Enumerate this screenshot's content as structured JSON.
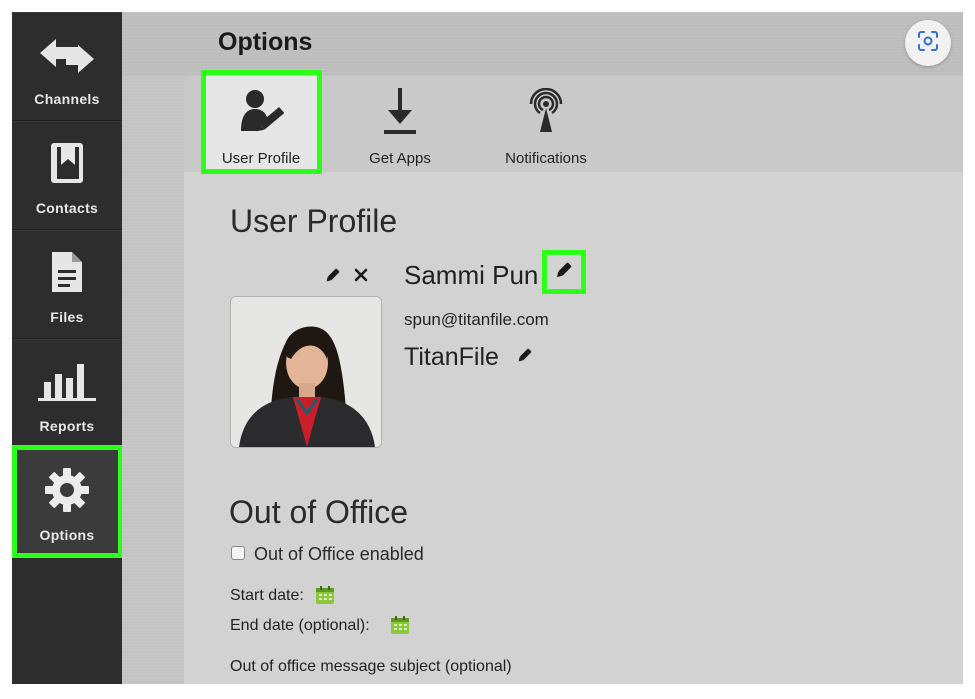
{
  "sidebar": {
    "items": [
      {
        "label": "Channels",
        "icon": "arrows-swap-icon"
      },
      {
        "label": "Contacts",
        "icon": "book-icon"
      },
      {
        "label": "Files",
        "icon": "file-icon"
      },
      {
        "label": "Reports",
        "icon": "bar-chart-icon"
      },
      {
        "label": "Options",
        "icon": "gear-icon",
        "active": true
      }
    ]
  },
  "header": {
    "title": "Options",
    "screenshot_icon": "screenshot-icon"
  },
  "tabs": [
    {
      "label": "User Profile",
      "icon": "user-edit-icon",
      "active": true
    },
    {
      "label": "Get Apps",
      "icon": "download-icon"
    },
    {
      "label": "Notifications",
      "icon": "broadcast-icon"
    }
  ],
  "user_profile": {
    "title": "User Profile",
    "name": "Sammi Pun",
    "email": "spun@titanfile.com",
    "company": "TitanFile"
  },
  "out_of_office": {
    "title": "Out of Office",
    "enabled_label": "Out of Office enabled",
    "enabled": false,
    "start_date_label": "Start date:",
    "end_date_label": "End date (optional):",
    "subject_label": "Out of office message subject (optional)"
  },
  "colors": {
    "sidebar_bg": "#2d2d2d",
    "highlight": "#2bff1a",
    "calendar_icon": "#8cc63f"
  }
}
